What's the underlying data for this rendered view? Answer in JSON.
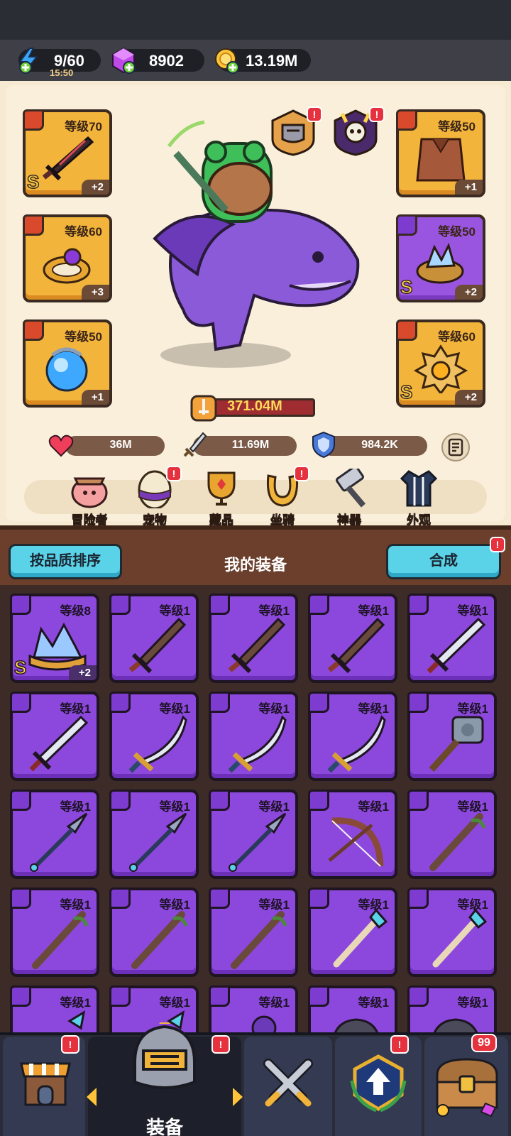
{
  "resources": {
    "energy": "9/60",
    "energy_timer": "15:50",
    "gems": "8902",
    "gold": "13.19M"
  },
  "equipped": {
    "left": [
      {
        "name": "sword-slot",
        "level": "等级70",
        "plus": "+2",
        "rank": "S"
      },
      {
        "name": "ring-slot",
        "level": "等级60",
        "plus": "+3",
        "rank": ""
      },
      {
        "name": "orb-slot",
        "level": "等级50",
        "plus": "+1",
        "rank": ""
      }
    ],
    "right": [
      {
        "name": "armor-slot",
        "level": "等级50",
        "plus": "+1",
        "rank": ""
      },
      {
        "name": "ring2-slot",
        "level": "等级50",
        "plus": "+2",
        "rank": "S"
      },
      {
        "name": "amulet-slot",
        "level": "等级60",
        "plus": "+2",
        "rank": "S"
      }
    ]
  },
  "power": "371.04M",
  "stats": {
    "hp": "36M",
    "attack": "11.69M",
    "defense": "984.2K"
  },
  "nav": [
    {
      "label": "冒险者"
    },
    {
      "label": "宠物"
    },
    {
      "label": "藏品"
    },
    {
      "label": "坐骑"
    },
    {
      "label": "神器"
    },
    {
      "label": "外观"
    }
  ],
  "inventory": {
    "sort_button": "按品质排序",
    "title": "我的装备",
    "merge_button": "合成",
    "items": [
      {
        "level": "等级8",
        "rank": "S",
        "plus": "+2",
        "kind": "crown"
      },
      {
        "level": "等级1",
        "kind": "greatsword"
      },
      {
        "level": "等级1",
        "kind": "greatsword"
      },
      {
        "level": "等级1",
        "kind": "greatsword"
      },
      {
        "level": "等级1",
        "kind": "steelsword"
      },
      {
        "level": "等级1",
        "kind": "steelsword"
      },
      {
        "level": "等级1",
        "kind": "scimitar"
      },
      {
        "level": "等级1",
        "kind": "scimitar"
      },
      {
        "level": "等级1",
        "kind": "scimitar"
      },
      {
        "level": "等级1",
        "kind": "hammer"
      },
      {
        "level": "等级1",
        "kind": "spear"
      },
      {
        "level": "等级1",
        "kind": "spear"
      },
      {
        "level": "等级1",
        "kind": "spear"
      },
      {
        "level": "等级1",
        "kind": "bow"
      },
      {
        "level": "等级1",
        "kind": "staff"
      },
      {
        "level": "等级1",
        "kind": "staff"
      },
      {
        "level": "等级1",
        "kind": "staff"
      },
      {
        "level": "等级1",
        "kind": "staff"
      },
      {
        "level": "等级1",
        "kind": "wand"
      },
      {
        "level": "等级1",
        "kind": "wand"
      },
      {
        "level": "等级1",
        "kind": "blue"
      },
      {
        "level": "等级1",
        "kind": "blue"
      },
      {
        "level": "等级1",
        "kind": "purple"
      },
      {
        "level": "等级1",
        "kind": "helm"
      },
      {
        "level": "等级1",
        "kind": "helm"
      }
    ]
  },
  "tabs": {
    "active_label": "装备",
    "chest_count": "99"
  },
  "colors": {
    "accent_cyan": "#5ad3e8",
    "item_purple": "#8c48dc",
    "epic_orange": "#f2b43b",
    "alert_red": "#e6323e"
  }
}
